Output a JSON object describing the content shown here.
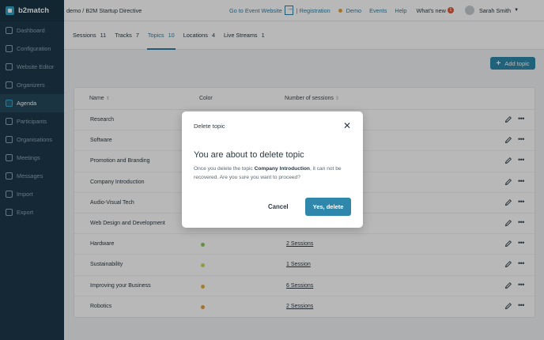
{
  "brand": {
    "name": "b2match"
  },
  "sidebar": {
    "items": [
      {
        "label": "Dashboard",
        "icon": "dashboard-icon",
        "active": false
      },
      {
        "label": "Configuration",
        "icon": "gear-icon",
        "active": false
      },
      {
        "label": "Website Editor",
        "icon": "website-icon",
        "active": false
      },
      {
        "label": "Organizers",
        "icon": "organizers-icon",
        "active": false
      },
      {
        "label": "Agenda",
        "icon": "calendar-icon",
        "active": true
      },
      {
        "label": "Participants",
        "icon": "participants-icon",
        "active": false
      },
      {
        "label": "Organisations",
        "icon": "organisations-icon",
        "active": false
      },
      {
        "label": "Meetings",
        "icon": "meetings-icon",
        "active": false
      },
      {
        "label": "Messages",
        "icon": "messages-icon",
        "active": false
      },
      {
        "label": "Import",
        "icon": "import-icon",
        "active": false
      },
      {
        "label": "Export",
        "icon": "export-icon",
        "active": false
      }
    ]
  },
  "topbar": {
    "event_title": "demo / B2M Startup Directive",
    "goto_label": "Go to Event Website",
    "separator": "|",
    "registration_label": "Registration",
    "demo_label": "Demo",
    "events_label": "Events",
    "help_label": "Help",
    "whats_new_label": "What's new",
    "whats_new_count": "1",
    "user_name": "Sarah Smith"
  },
  "tabs": [
    {
      "label": "Sessions",
      "count": "11",
      "active": false
    },
    {
      "label": "Tracks",
      "count": "7",
      "active": false
    },
    {
      "label": "Topics",
      "count": "10",
      "active": true
    },
    {
      "label": "Locations",
      "count": "4",
      "active": false
    },
    {
      "label": "Live Streams",
      "count": "1",
      "active": false
    }
  ],
  "add_topic_label": "Add topic",
  "table": {
    "headers": {
      "name": "Name",
      "color": "Color",
      "sessions": "Number of sessions",
      "sort_glyph": "⇕"
    },
    "rows": [
      {
        "name": "Research",
        "color": "",
        "sessions": ""
      },
      {
        "name": "Software",
        "color": "",
        "sessions": ""
      },
      {
        "name": "Promotion and Branding",
        "color": "",
        "sessions": ""
      },
      {
        "name": "Company Introduction",
        "color": "",
        "sessions": ""
      },
      {
        "name": "Audio-Visual Tech",
        "color": "",
        "sessions": ""
      },
      {
        "name": "Web Design and Development",
        "color": "",
        "sessions": ""
      },
      {
        "name": "Hardware",
        "color": "#8cc65a",
        "sessions": "2 Sessions"
      },
      {
        "name": "Sustainability",
        "color": "#c9d85a",
        "sessions": "1 Session"
      },
      {
        "name": "Improving your Business",
        "color": "#e0b043",
        "sessions": "6 Sessions"
      },
      {
        "name": "Robotics",
        "color": "#e0a043",
        "sessions": "2 Sessions"
      }
    ]
  },
  "modal": {
    "header": "Delete topic",
    "title": "You are about to delete topic",
    "body_before": "Once you delete the topic ",
    "topic_name": "Company Introduction",
    "body_after": ", it can not be recovered. Are you sure you want to proceed?",
    "cancel_label": "Cancel",
    "confirm_label": "Yes, delete"
  },
  "colors": {
    "accent": "#2f88ab",
    "sidebar_bg": "#1c3a4a",
    "link": "#2f7fa3"
  }
}
